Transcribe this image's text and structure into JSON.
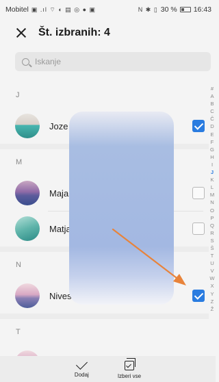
{
  "status_bar": {
    "carrier": "Mobitel",
    "icons": "▣ .ıl ⌔ ◐ ▤ ◎ ● ▣",
    "right_icons": "N ✱ ▯",
    "battery": "30 %",
    "time": "16:43"
  },
  "header": {
    "title": "Št. izbranih: 4"
  },
  "search": {
    "placeholder": "Iskanje"
  },
  "sections": [
    {
      "letter": "J",
      "contacts": [
        {
          "name": "Joze",
          "checked": true,
          "avatar": "sea"
        }
      ]
    },
    {
      "letter": "M",
      "contacts": [
        {
          "name": "Maja",
          "checked": false,
          "avatar": "mountain"
        },
        {
          "name": "Matja",
          "checked": false,
          "avatar": "wave"
        }
      ]
    },
    {
      "letter": "N",
      "contacts": [
        {
          "name": "Nives",
          "checked": true,
          "avatar": "pink-mountain"
        }
      ]
    },
    {
      "letter": "T",
      "contacts": []
    }
  ],
  "index_letters": [
    "#",
    "A",
    "B",
    "C",
    "Č",
    "D",
    "E",
    "F",
    "G",
    "H",
    "I",
    "J",
    "K",
    "L",
    "M",
    "N",
    "O",
    "P",
    "Q",
    "R",
    "S",
    "Š",
    "T",
    "U",
    "V",
    "W",
    "X",
    "Y",
    "Z",
    "Ž"
  ],
  "active_index": "J",
  "bottom_bar": {
    "add_label": "Dodaj",
    "select_all_label": "Izberi vse"
  },
  "colors": {
    "accent": "#2a7ce0",
    "arrow": "#e8833a"
  }
}
